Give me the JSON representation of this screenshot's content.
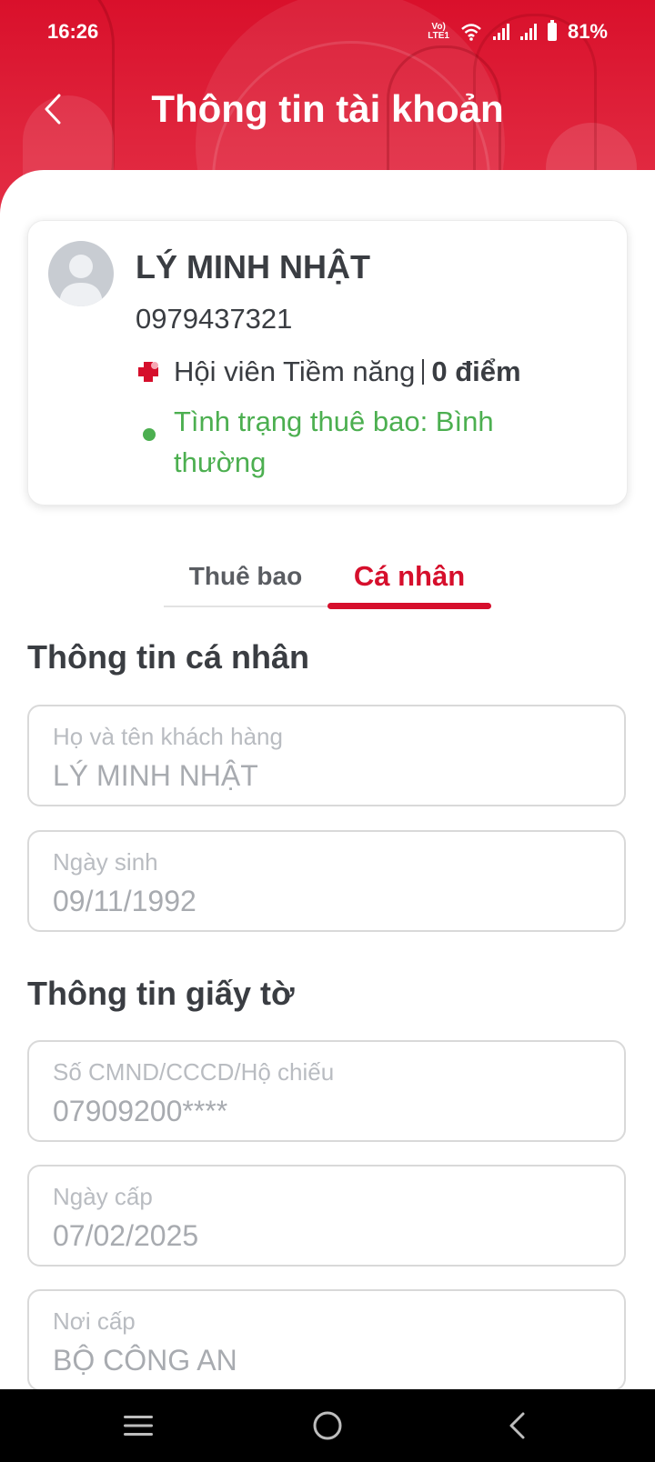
{
  "status_bar": {
    "time": "16:26",
    "network": "VoLTE",
    "battery": "81%"
  },
  "header": {
    "title": "Thông tin tài khoản",
    "brand_color": "#d9102b"
  },
  "profile": {
    "name": "LÝ MINH NHẬT",
    "phone": "0979437321",
    "member_tier": "Hội viên Tiềm năng",
    "points": "0 điểm",
    "subscription_status": "Tình trạng thuê bao: Bình thường",
    "status_color": "#4caf50"
  },
  "tabs": [
    {
      "label": "Thuê bao",
      "active": false
    },
    {
      "label": "Cá nhân",
      "active": true
    }
  ],
  "personal_section": {
    "title": "Thông tin cá nhân",
    "fields": [
      {
        "label": "Họ và tên khách hàng",
        "value": "LÝ MINH NHẬT"
      },
      {
        "label": "Ngày sinh",
        "value": "09/11/1992"
      }
    ]
  },
  "document_section": {
    "title": "Thông tin giấy tờ",
    "fields": [
      {
        "label": "Số CMND/CCCD/Hộ chiếu",
        "value": "07909200****"
      },
      {
        "label": "Ngày cấp",
        "value": "07/02/2025"
      },
      {
        "label": "Nơi cấp",
        "value": "BỘ CÔNG AN"
      }
    ]
  },
  "icons": {
    "back": "chevron-left-icon",
    "avatar": "user-placeholder-icon",
    "member": "health-cross-icon",
    "nav_menu": "menu-icon",
    "nav_home": "home-circle-icon",
    "nav_back": "back-icon"
  }
}
